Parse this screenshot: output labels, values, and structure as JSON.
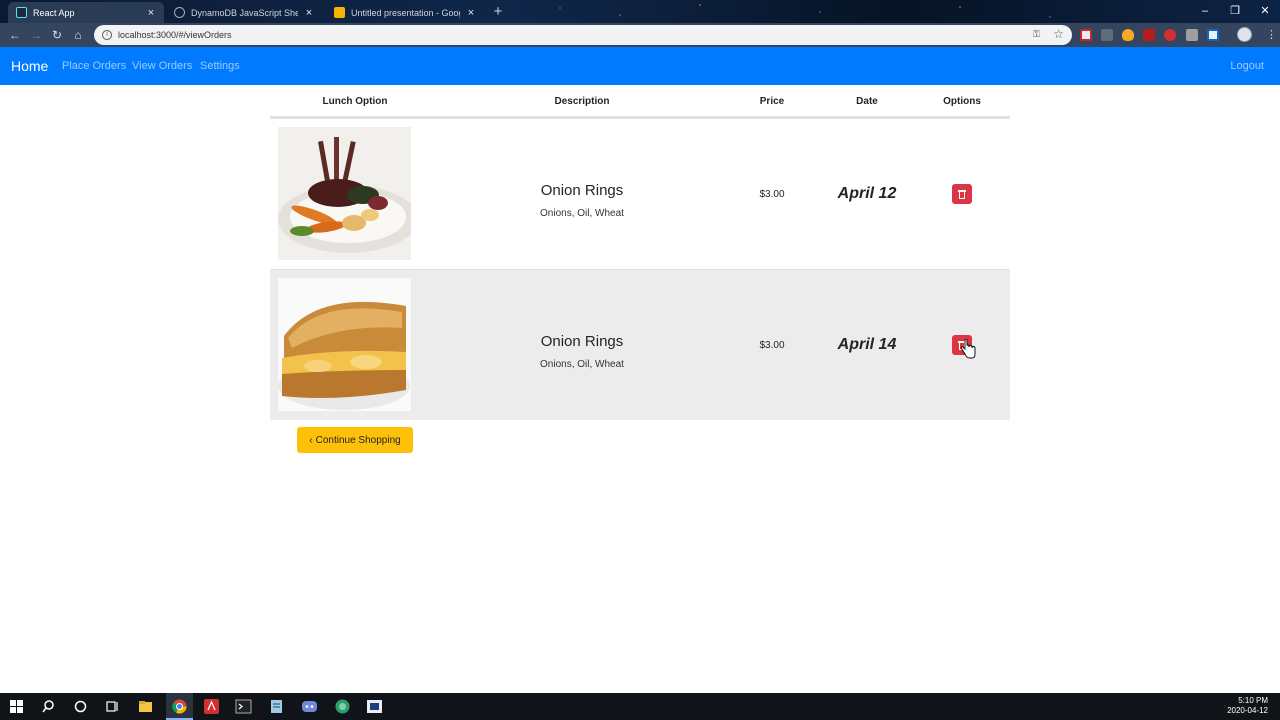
{
  "browser": {
    "tabs": [
      {
        "title": "React App",
        "active": true
      },
      {
        "title": "DynamoDB JavaScript Shell",
        "active": false
      },
      {
        "title": "Untitled presentation - Google S",
        "active": false
      }
    ],
    "url": "localhost:3000/#/viewOrders"
  },
  "navbar": {
    "brand": "Home",
    "links": [
      "Place Orders",
      "View Orders",
      "Settings"
    ],
    "logout": "Logout",
    "color": "#007bff"
  },
  "table": {
    "headers": [
      "Lunch Option",
      "Description",
      "Price",
      "Date",
      "Options"
    ],
    "rows": [
      {
        "image": "lamb-chops-plate",
        "name": "Onion Rings",
        "description": "Onions, Oil, Wheat",
        "price": "$3.00",
        "date": "April 12",
        "action_icon": "trash-icon"
      },
      {
        "image": "grilled-cheese-sandwich",
        "name": "Onion Rings",
        "description": "Onions, Oil, Wheat",
        "price": "$3.00",
        "date": "April 14",
        "action_icon": "trash-icon"
      }
    ]
  },
  "continue_button": {
    "label": "Continue Shopping",
    "icon": "chevron-left-icon",
    "color": "#ffc107"
  },
  "delete_color": "#dc3545",
  "taskbar": {
    "icons": [
      "windows-start-icon",
      "search-icon",
      "cortana-icon",
      "task-view-icon",
      "file-explorer-icon",
      "chrome-icon",
      "acrobat-icon",
      "terminal-icon",
      "notepad-icon",
      "discord-icon",
      "app-icon",
      "app-icon"
    ],
    "time": "5:10 PM",
    "date": "2020-04-12"
  }
}
